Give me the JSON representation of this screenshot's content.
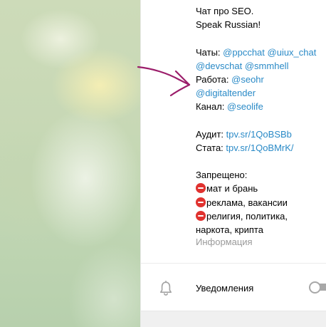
{
  "description": {
    "line1": "Чат про SEO.",
    "line2": "Speak Russian!",
    "chats_label": "Чаты:",
    "chats_link1": "@ppcchat",
    "chats_link2": "@uiux_chat",
    "chats_link3": "@devschat",
    "chats_link4": "@smmhell",
    "work_label": "Работа:",
    "work_link1": "@seohr",
    "work_link2": "@digitaltender",
    "channel_label": "Канал:",
    "channel_link": "@seolife",
    "audit_label": "Аудит:",
    "audit_link": "tpv.sr/1QoBSBb",
    "stats_label": "Стата:",
    "stats_link": "tpv.sr/1QoBMrK/",
    "forbidden_title": "Запрещено:",
    "rule1": "мат и брань",
    "rule2": "реклама, вакансии",
    "rule3": "религия, политика,",
    "rule3_cont": "наркота, крипта"
  },
  "caption": "Информация",
  "notifications": {
    "label": "Уведомления",
    "enabled": false
  },
  "colors": {
    "link": "#2a8ac7",
    "annotation": "#9b1d6a",
    "forbidden_emoji": "#e0322f",
    "toggle_off": "#a8a8a8"
  },
  "icons": {
    "notification": "bell-icon",
    "rule_marker": "no-entry-emoji-icon"
  }
}
